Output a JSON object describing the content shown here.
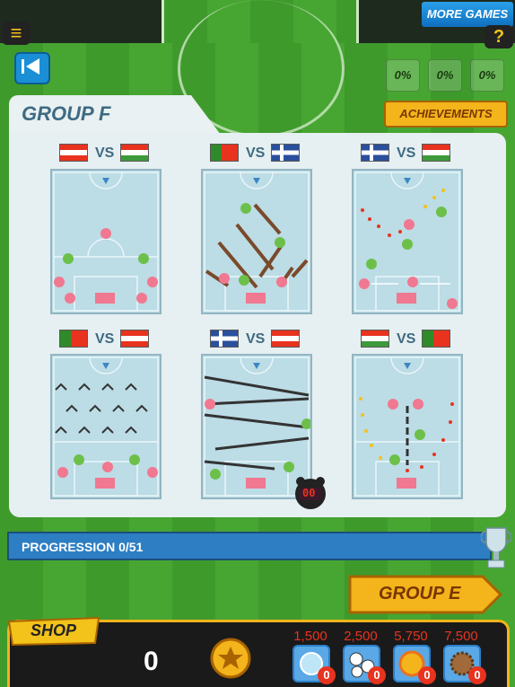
{
  "header": {
    "menu_icon": "hamburger-icon",
    "help_label": "?",
    "more_games_label": "MORE GAMES",
    "back_icon": "back-arrow-icon",
    "percent_badges": [
      "0%",
      "0%",
      "0%"
    ]
  },
  "group": {
    "title": "GROUP F",
    "achievements_label": "ACHIEVEMENTS",
    "vs_label": "VS",
    "matches": [
      {
        "home": "Austria",
        "away": "Hungary"
      },
      {
        "home": "Portugal",
        "away": "Iceland"
      },
      {
        "home": "Iceland",
        "away": "Hungary"
      },
      {
        "home": "Portugal",
        "away": "Austria"
      },
      {
        "home": "Iceland",
        "away": "Austria"
      },
      {
        "home": "Hungary",
        "away": "Portugal"
      }
    ],
    "timer_icon": "alarm-clock-icon",
    "timer_value": "00"
  },
  "progression": {
    "label": "PROGRESSION 0/51",
    "value": 0,
    "total": 51
  },
  "next_group": {
    "label": "GROUP E"
  },
  "shop": {
    "label": "SHOP",
    "coins": "0",
    "coin_icon": "star-coin-icon",
    "items": [
      {
        "price": "1,500",
        "count": "0",
        "icon": "ice-ball-icon"
      },
      {
        "price": "2,500",
        "count": "0",
        "icon": "multi-ball-icon"
      },
      {
        "price": "5,750",
        "count": "0",
        "icon": "fire-ball-icon"
      },
      {
        "price": "7,500",
        "count": "0",
        "icon": "hedgehog-ball-icon"
      }
    ]
  },
  "colors": {
    "accent": "#f3b41c",
    "panel": "#e6eff1",
    "title": "#3e6a82",
    "price": "#e8331f"
  }
}
